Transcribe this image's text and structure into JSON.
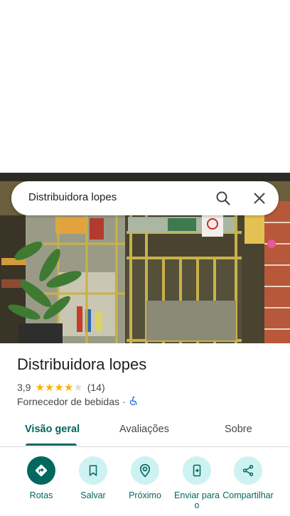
{
  "search": {
    "query": "Distribuidora lopes"
  },
  "place": {
    "name": "Distribuidora lopes",
    "rating": "3,9",
    "rating_value": 3.9,
    "review_count": "(14)",
    "category": "Fornecedor de bebidas",
    "separator": "·"
  },
  "tabs": [
    {
      "label": "Visão geral",
      "active": true
    },
    {
      "label": "Avaliações",
      "active": false
    },
    {
      "label": "Sobre",
      "active": false
    }
  ],
  "actions": [
    {
      "label": "Rotas",
      "icon": "directions-icon"
    },
    {
      "label": "Salvar",
      "icon": "bookmark-icon"
    },
    {
      "label": "Próximo",
      "icon": "nearby-icon"
    },
    {
      "label": "Enviar para o",
      "icon": "send-to-phone-icon"
    },
    {
      "label": "Compartilhar",
      "icon": "share-icon"
    }
  ],
  "colors": {
    "accent": "#00685e",
    "action_bg": "#cdf2f1",
    "star": "#f4b400"
  }
}
